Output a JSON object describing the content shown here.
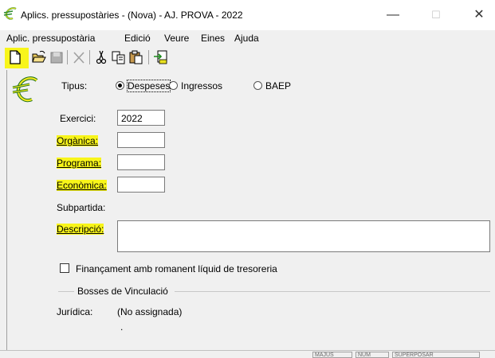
{
  "window": {
    "title": "Aplics. pressupostàries - (Nova) - AJ. PROVA - 2022",
    "minimize_glyph": "—",
    "maximize_glyph": "☐",
    "close_glyph": "✕"
  },
  "menu": [
    "Aplic. pressupostària",
    "Edició",
    "Veure",
    "Eines",
    "Ajuda"
  ],
  "toolbar": {
    "icons": [
      "new-document-icon",
      "open-folder-icon",
      "save-icon",
      "delete-icon",
      "cut-icon",
      "copy-icon",
      "paste-icon",
      "export-icon"
    ],
    "highlight_color": "#f8f51a"
  },
  "form": {
    "tipus_label": "Tipus:",
    "tipus_options": [
      "Despeses",
      "Ingressos",
      "BAEP"
    ],
    "tipus_selected": "Despeses",
    "exercici_label": "Exercici:",
    "exercici_value": "2022",
    "organica_label": "Orgànica:",
    "organica_value": "",
    "programa_label": "Programa:",
    "programa_value": "",
    "economica_label": "Econòmica:",
    "economica_value": "",
    "subpartida_label": "Subpartida:",
    "descripcio_label": "Descripció:",
    "descripcio_value": "",
    "financament_label": "Finançament amb romanent líquid de tresoreria",
    "financament_checked": false,
    "bosses_label": "Bosses de Vinculació",
    "juridica_label": "Jurídica:",
    "juridica_value": "(No assignada)",
    "dot_value": "."
  },
  "statusbar": [
    "MAJÚS",
    "NUM",
    "SUPERPOSAR"
  ]
}
